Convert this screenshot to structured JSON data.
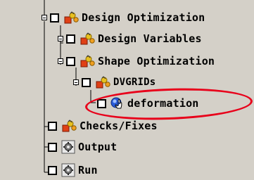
{
  "tree": {
    "items": [
      {
        "label": "Design Optimization",
        "icon": "folder-wizard-icon",
        "expanded": true
      },
      {
        "label": "Design Variables",
        "icon": "folder-wizard-icon",
        "expanded": false
      },
      {
        "label": "Shape Optimization",
        "icon": "folder-wizard-icon",
        "expanded": true
      },
      {
        "label": "DVGRIDs",
        "icon": "folder-wizard-icon",
        "expanded": true
      },
      {
        "label": "deformation",
        "icon": "pointer-hand-icon"
      },
      {
        "label": "Checks/Fixes",
        "icon": "folder-wizard-icon"
      },
      {
        "label": "Output",
        "icon": "gear-icon"
      },
      {
        "label": "Run",
        "icon": "gear-icon"
      }
    ]
  },
  "highlight": {
    "color": "#e8001a",
    "target": "deformation"
  }
}
